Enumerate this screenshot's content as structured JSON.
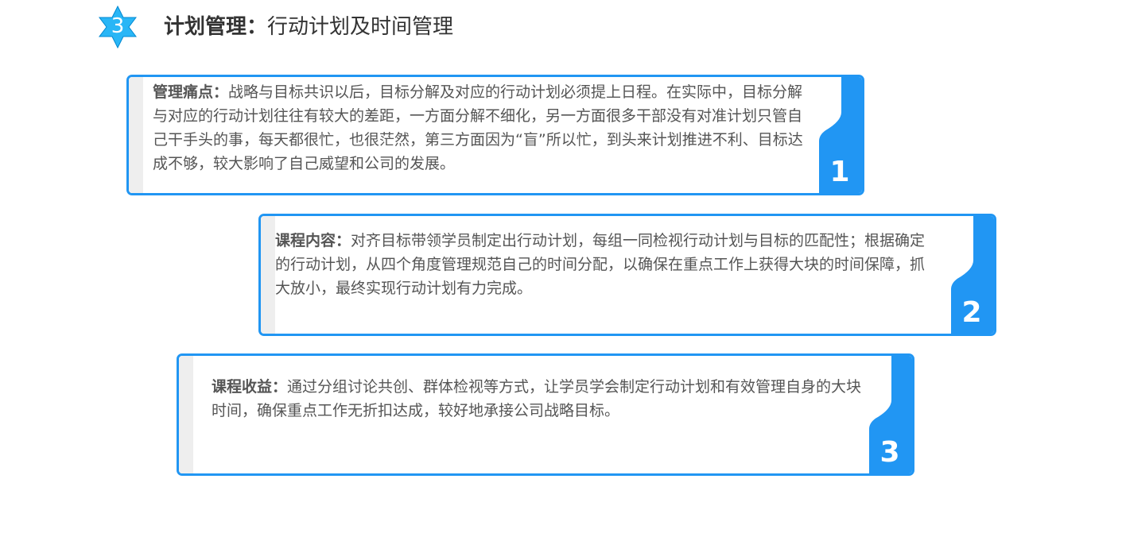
{
  "header": {
    "step_number": "3",
    "title_bold": "计划管理：",
    "title_rest": "行动计划及时间管理"
  },
  "colors": {
    "accent": "#2196f3",
    "badge": "#29b6f6",
    "text": "#555555"
  },
  "cards": [
    {
      "number": "1",
      "label": "管理痛点：",
      "text": "战略与目标共识以后，目标分解及对应的行动计划必须提上日程。在实际中，目标分解与对应的行动计划往往有较大的差距，一方面分解不细化，另一方面很多干部没有对准计划只管自己干手头的事，每天都很忙，也很茫然，第三方面因为“盲”所以忙，到头来计划推进不利、目标达成不够，较大影响了自己威望和公司的发展。"
    },
    {
      "number": "2",
      "label": "课程内容：",
      "text": "对齐目标带领学员制定出行动计划，每组一同检视行动计划与目标的匹配性；根据确定的行动计划，从四个角度管理规范自己的时间分配，以确保在重点工作上获得大块的时间保障，抓大放小，最终实现行动计划有力完成。"
    },
    {
      "number": "3",
      "label": "课程收益：",
      "text": "通过分组讨论共创、群体检视等方式，让学员学会制定行动计划和有效管理自身的大块时间，确保重点工作无折扣达成，较好地承接公司战略目标。"
    }
  ]
}
